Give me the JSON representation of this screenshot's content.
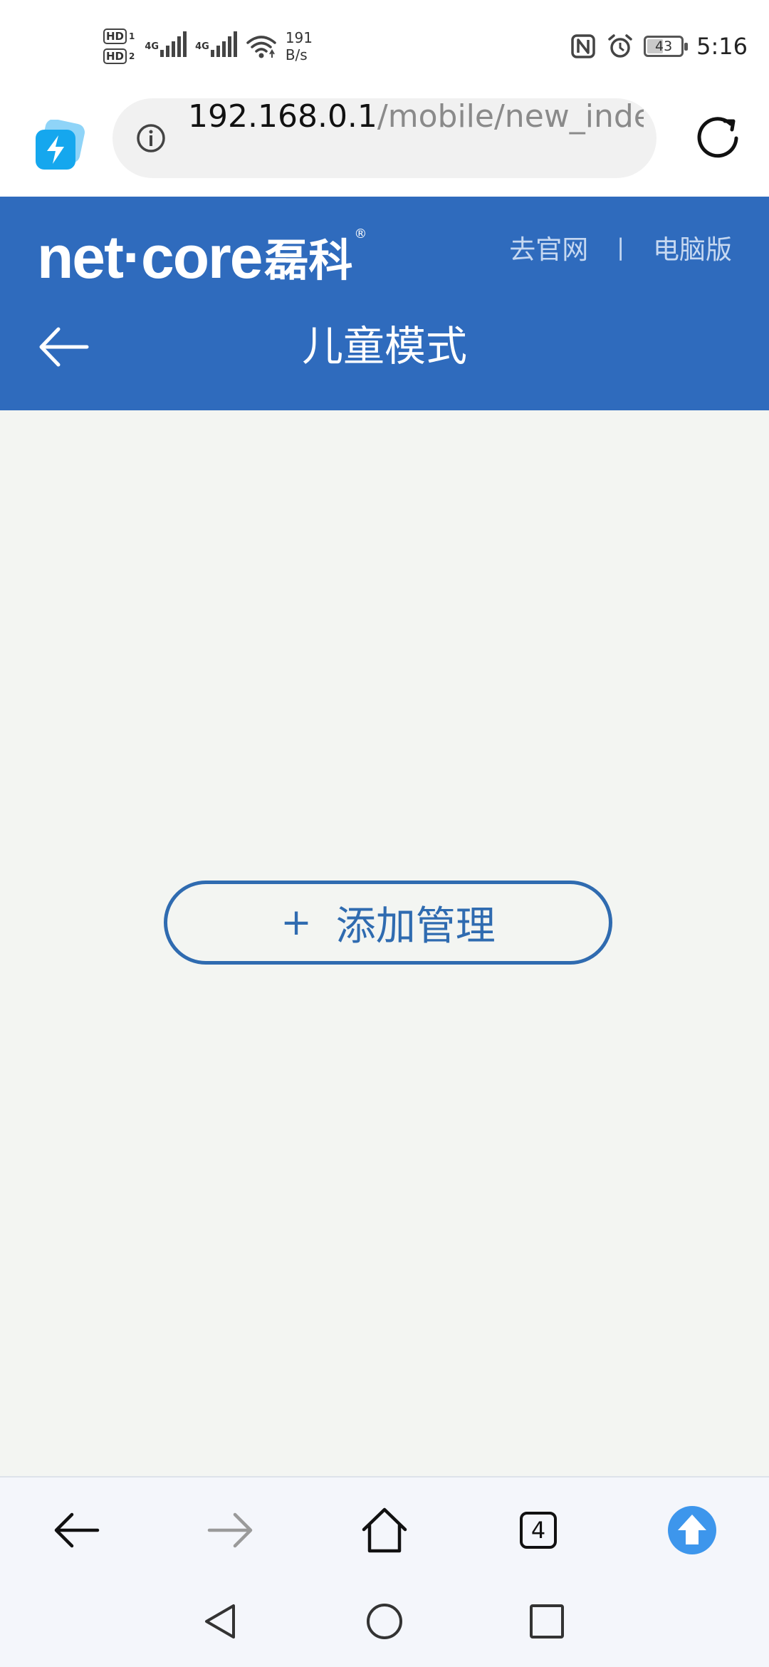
{
  "status_bar": {
    "hd1": "HD",
    "hd1_sub": "1",
    "hd2": "HD",
    "hd2_sub": "2",
    "network1": "4G",
    "network2": "4G",
    "speed_value": "191",
    "speed_unit": "B/s",
    "battery_level": "43",
    "time": "5:16"
  },
  "browser": {
    "url_host": "192.168.0.1",
    "url_path": "/mobile/new_index",
    "tab_count": "4"
  },
  "header": {
    "logo_en": "net·core",
    "logo_cn": "磊科",
    "logo_reg": "®",
    "link_official": "去官网",
    "link_separator": "|",
    "link_desktop": "电脑版",
    "title": "儿童模式"
  },
  "content": {
    "add_button_plus": "+",
    "add_button_label": "添加管理"
  },
  "colors": {
    "header_bg": "#2f6bbd",
    "accent": "#2f6bb0",
    "content_bg": "#f3f5f2"
  },
  "icons": {
    "bolt": "bolt-icon",
    "info": "info-icon",
    "reload": "reload-icon",
    "back": "arrow-left-icon",
    "forward": "arrow-right-icon",
    "home": "home-icon",
    "upload": "upload-arrow-icon",
    "nav_back": "triangle-back-icon",
    "nav_home": "circle-home-icon",
    "nav_recent": "square-recent-icon"
  }
}
